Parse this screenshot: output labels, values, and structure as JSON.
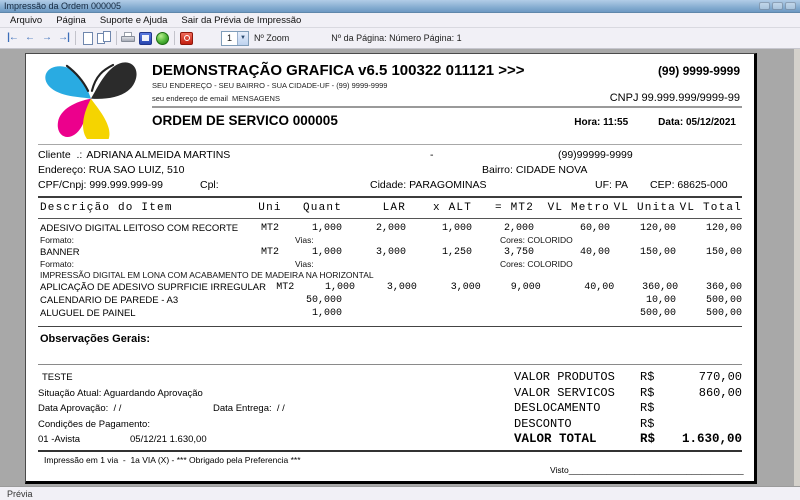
{
  "window": {
    "title": "Impressão da Ordem 000005",
    "status": "Prévia"
  },
  "menubar": {
    "items": [
      {
        "label": "Arquivo"
      },
      {
        "label": "Página"
      },
      {
        "label": "Suporte e Ajuda"
      },
      {
        "label": "Sair da Prévia de Impressão"
      }
    ]
  },
  "toolbar": {
    "nav": [
      "|←",
      "←",
      "→",
      "→|"
    ],
    "zoom_value": "1",
    "combo_arrow": "▼",
    "zoom_label": "Nº Zoom",
    "page_label": "Nº da Página: Número Página: 1",
    "icons": [
      "first-page",
      "previous-page",
      "next-page",
      "last-page",
      "single-page",
      "two-pages",
      "printer",
      "print-setup",
      "export",
      "exit"
    ]
  },
  "doc": {
    "company": {
      "name": "DEMONSTRAÇÃO GRAFICA v6.5 100322 011121 >>>",
      "phone": "(99) 9999-9999",
      "address": "SEU ENDEREÇO - SEU BAIRRO - SUA CIDADE-UF - (99) 9999-9999",
      "email": "seu endereço de email  MENSAGENS",
      "cnpj": "CNPJ 99.999.999/9999-99"
    },
    "order": {
      "title": "ORDEM DE SERVICO 000005",
      "hora": "Hora: 11:55",
      "data": "Data: 05/12/2021"
    },
    "client": {
      "cliente_label": "Cliente  .:",
      "cliente": "ADRIANA ALMEIDA MARTINS",
      "dash": "-",
      "phone": "(99)99999-9999",
      "endereco": "Endereço: RUA SAO LUIZ, 510",
      "bairro": "Bairro: CIDADE NOVA",
      "cpf": "CPF/Cnpj: 999.999.999-99",
      "cpl": "Cpl:",
      "cidade": "Cidade: PARAGOMINAS",
      "uf": "UF: PA",
      "cep": "CEP: 68625-000"
    },
    "table": {
      "headers": {
        "desc": "Descrição do Item",
        "uni": "Uni",
        "quant": "Quant",
        "lar": "LAR",
        "alt": "x ALT",
        "mt2": "= MT2",
        "metro": "VL Metro",
        "unita": "VL Unita",
        "total": "VL Total"
      },
      "rows": [
        {
          "desc": "ADESIVO DIGITAL LEITOSO COM RECORTE",
          "uni": "MT2",
          "quant": "1,000",
          "lar": "2,000",
          "alt": "1,000",
          "mt2": "2,000",
          "metro": "60,00",
          "unita": "120,00",
          "total": "120,00",
          "formato": "Formato:",
          "vias": "Vias:",
          "cores": "Cores: COLORIDO"
        },
        {
          "desc": "BANNER",
          "uni": "MT2",
          "quant": "1,000",
          "lar": "3,000",
          "alt": "1,250",
          "mt2": "3,750",
          "metro": "40,00",
          "unita": "150,00",
          "total": "150,00",
          "formato": "Formato:",
          "vias": "Vias:",
          "cores": "Cores: COLORIDO",
          "note": "IMPRESSÃO DIGITAL EM LONA COM ACABAMENTO DE MADEIRA NA HORIZONTAL"
        },
        {
          "desc": "APLICAÇÃO DE ADESIVO SUPRFICIE IRREGULAR",
          "uni": "MT2",
          "quant": "1,000",
          "lar": "3,000",
          "alt": "3,000",
          "mt2": "9,000",
          "metro": "40,00",
          "unita": "360,00",
          "total": "360,00"
        },
        {
          "desc": "CALENDARIO DE PAREDE - A3",
          "uni": "",
          "quant": "50,000",
          "lar": "",
          "alt": "",
          "mt2": "",
          "metro": "",
          "unita": "10,00",
          "total": "500,00"
        },
        {
          "desc": "ALUGUEL DE PAINEL",
          "uni": "",
          "quant": "1,000",
          "lar": "",
          "alt": "",
          "mt2": "",
          "metro": "",
          "unita": "500,00",
          "total": "500,00"
        }
      ]
    },
    "obs_title": "Observações Gerais:",
    "footer": {
      "teste": "TESTE",
      "situacao": "Situação Atual: Aguardando Aprovação",
      "data_aprovacao": "Data Aprovação:  / /",
      "data_entrega": "Data Entrega:  / /",
      "cond_label": "Condições de Pagamento:",
      "cond_item": "01 -Avista",
      "cond_value": "05/12/21 1.630,00",
      "totals": [
        {
          "label": "VALOR PRODUTOS",
          "cur": "R$",
          "value": "770,00"
        },
        {
          "label": "VALOR SERVICOS",
          "cur": "R$",
          "value": "860,00"
        },
        {
          "label": "DESLOCAMENTO",
          "cur": "R$",
          "value": ""
        },
        {
          "label": "DESCONTO",
          "cur": "R$",
          "value": ""
        },
        {
          "label": "VALOR TOTAL",
          "cur": "R$",
          "value": "1.630,00"
        }
      ],
      "print_note": "Impressão em 1 via  -  1a VIA (X) - *** Obrigado pela Preferencia ***",
      "visto": "Visto_____________________________________"
    },
    "colors": {
      "cyan": "#29abe2",
      "magenta": "#ec008c",
      "yellow": "#f5d400",
      "black": "#2b2b2b"
    }
  }
}
